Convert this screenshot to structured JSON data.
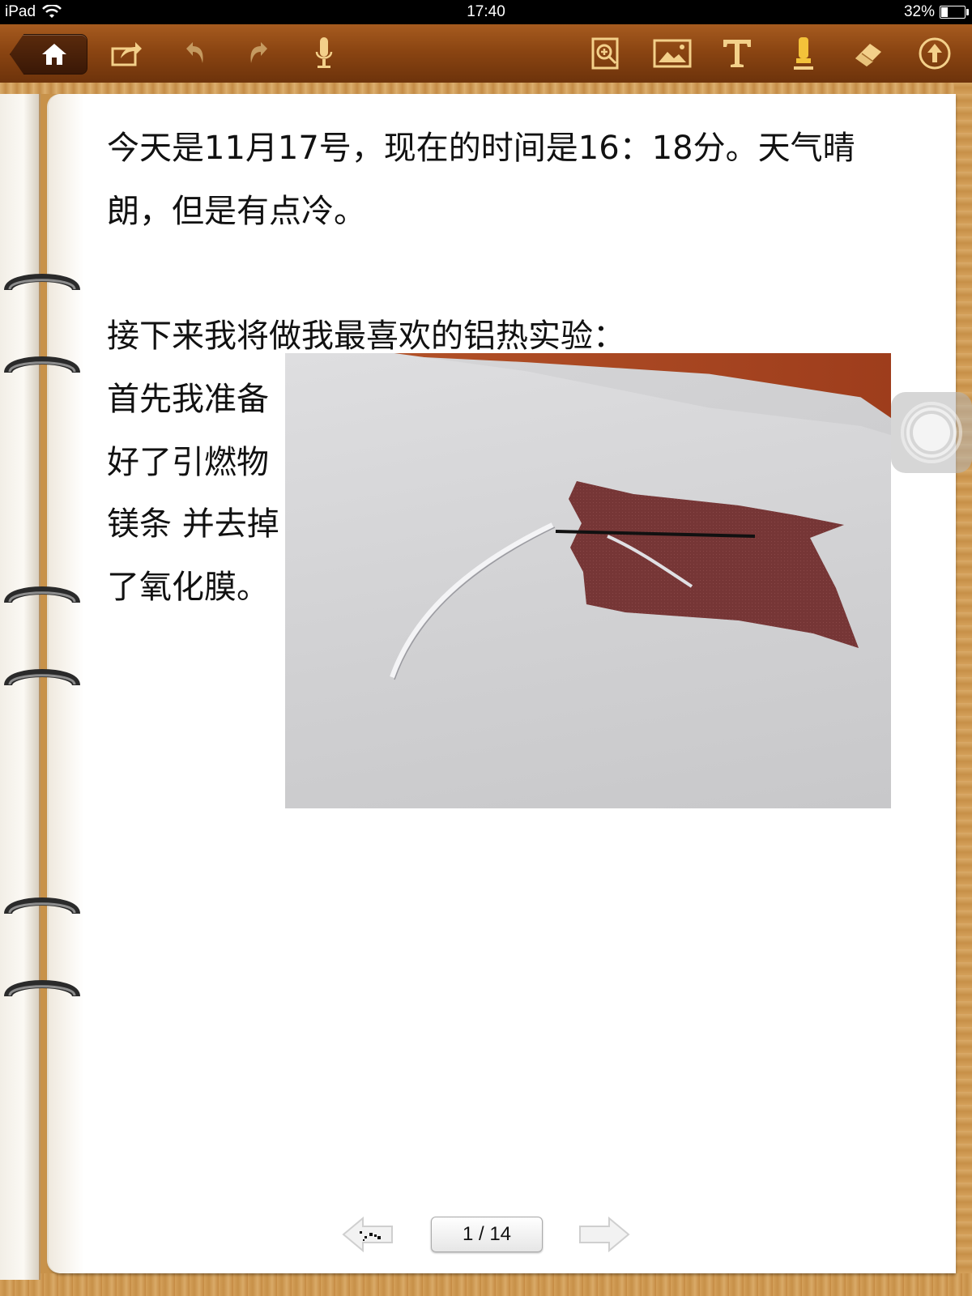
{
  "status_bar": {
    "device": "iPad",
    "time": "17:40",
    "battery": "32%",
    "battery_level": 0.32
  },
  "toolbar": {
    "left_icons": [
      "home-icon",
      "share-icon",
      "undo-icon",
      "redo-icon",
      "microphone-icon"
    ],
    "right_icons": [
      "zoom-page-icon",
      "insert-image-icon",
      "text-tool-icon",
      "marker-icon",
      "eraser-icon",
      "upload-icon"
    ]
  },
  "note": {
    "lines": [
      "今天是11月17号，现在的时间是16：18分。天气晴",
      "朗，但是有点冷。",
      "接下来我将做我最喜欢的铝热实验：",
      "首先我准备",
      "好了引燃物",
      "镁条 并去掉",
      "了氧化膜。"
    ]
  },
  "pager": {
    "label": "1 / 14",
    "current_page": 1,
    "total_pages": 14
  }
}
